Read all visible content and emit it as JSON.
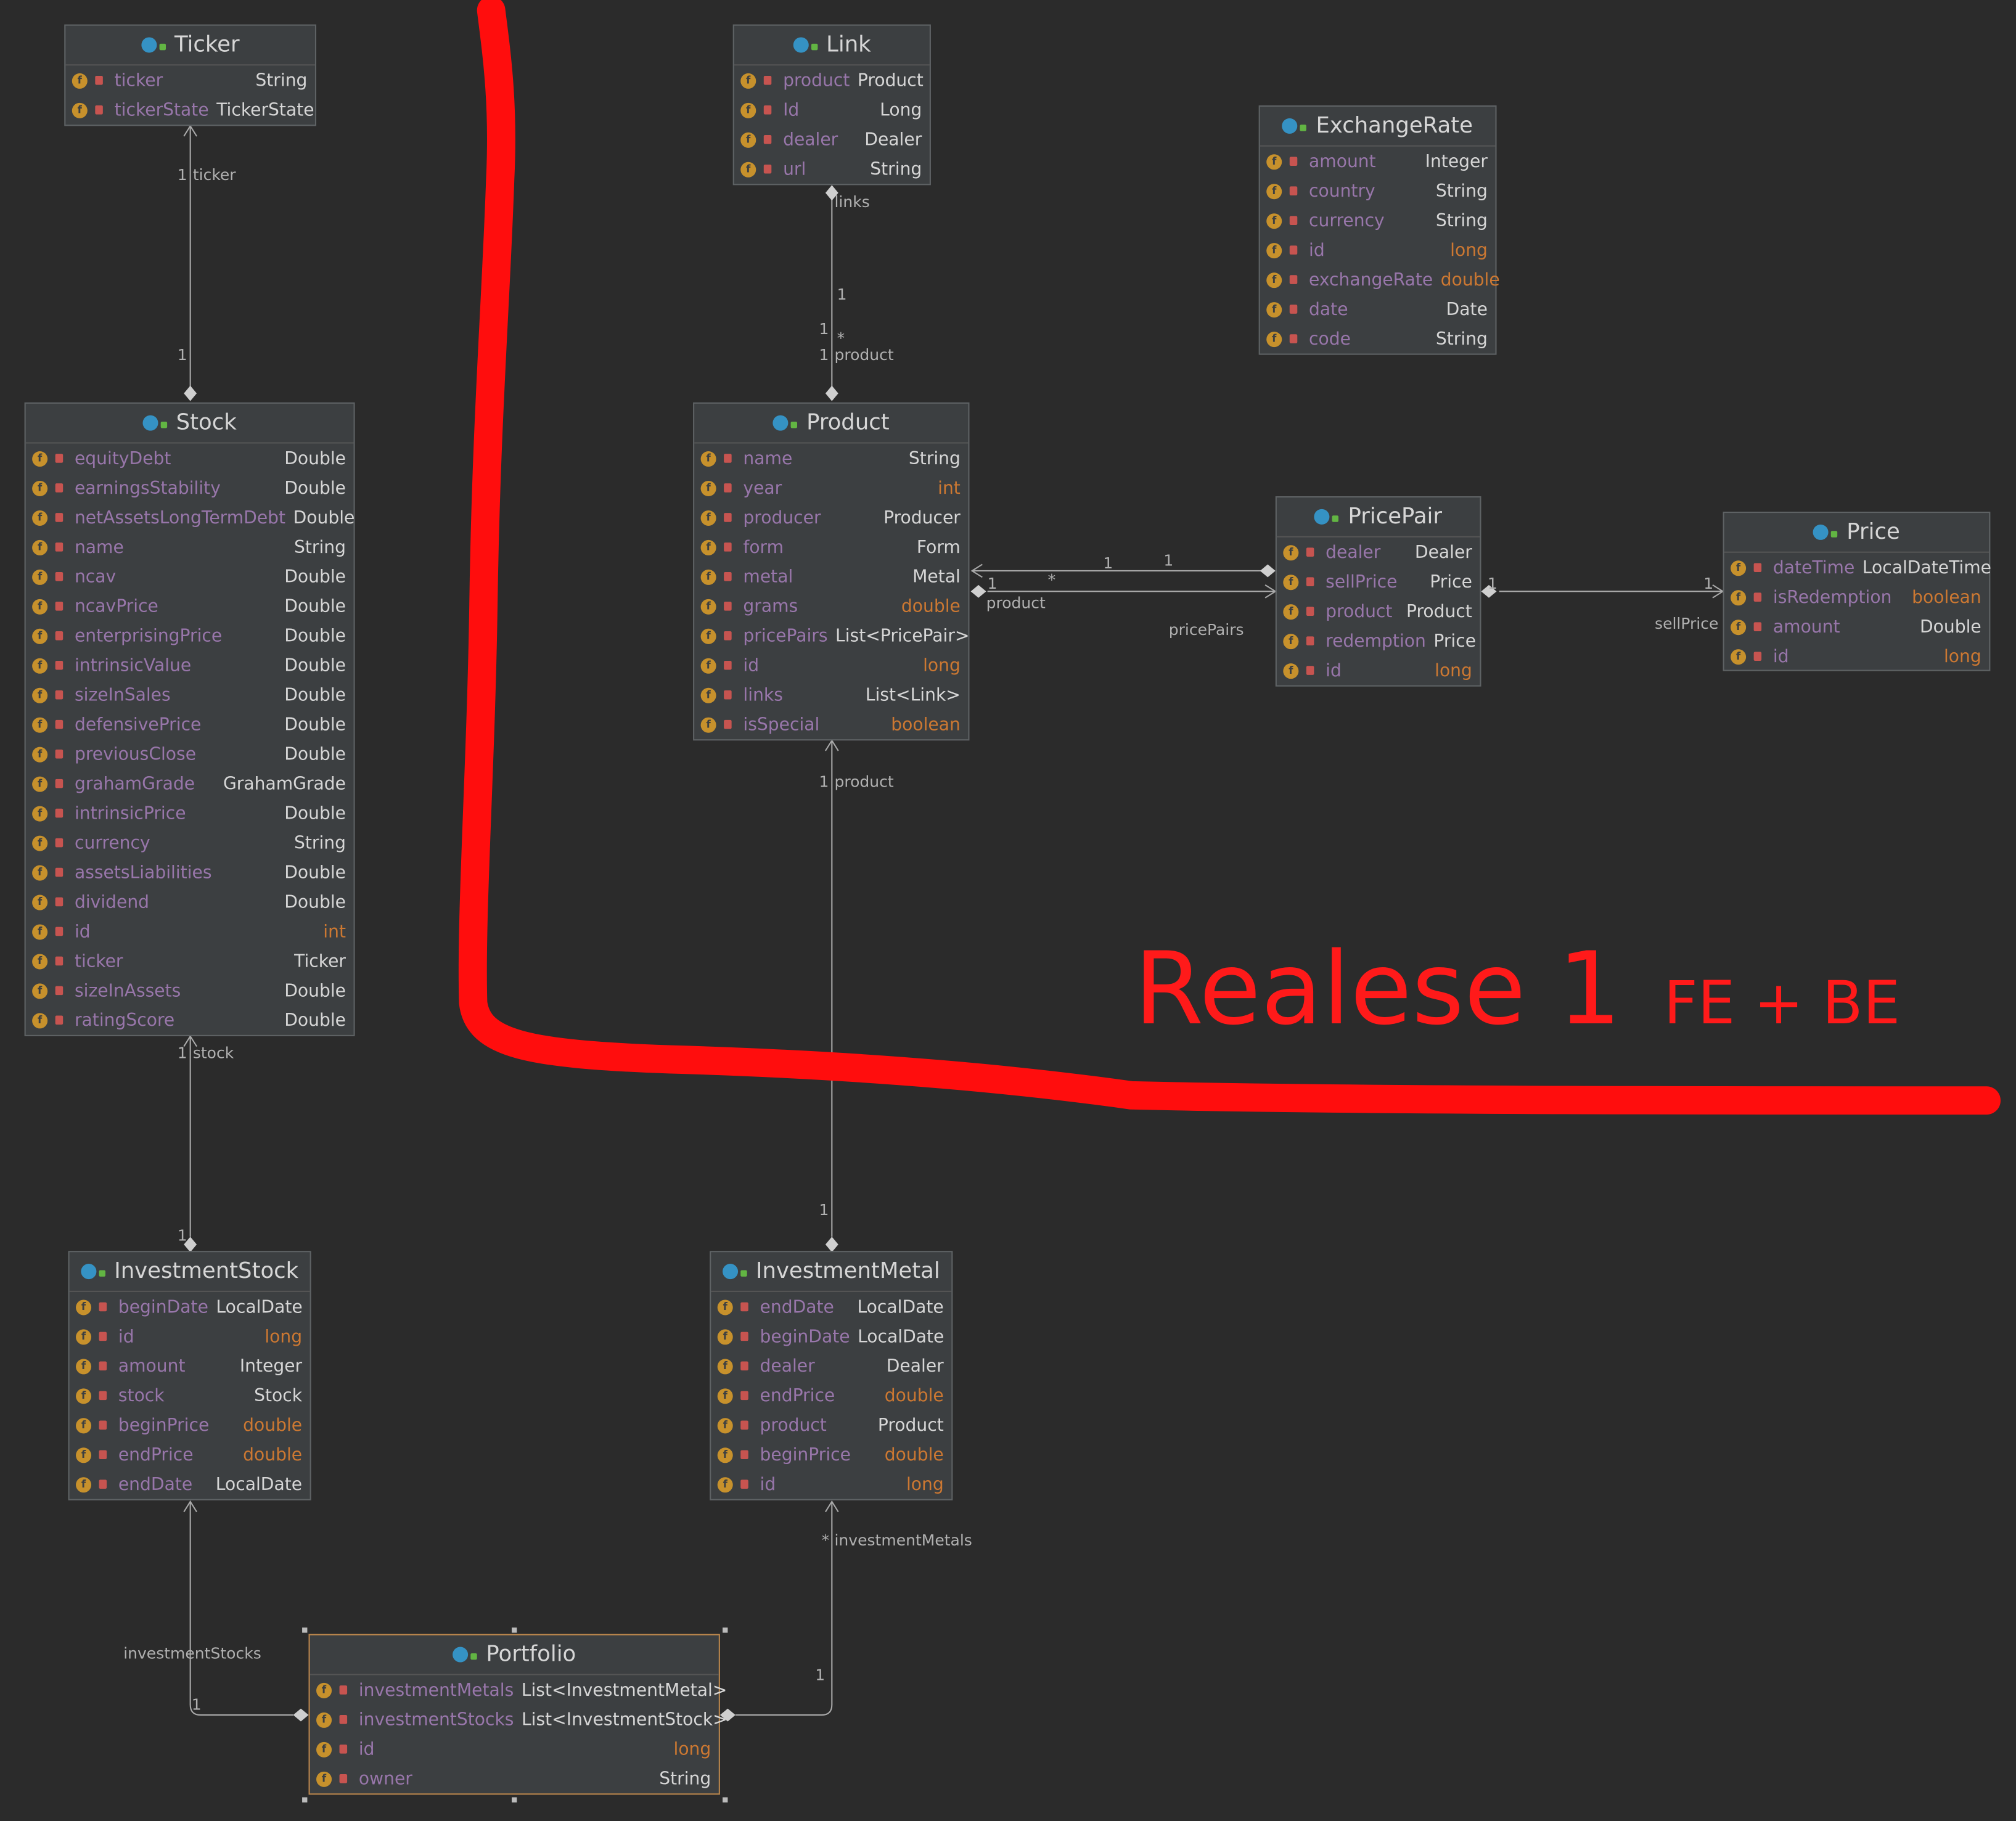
{
  "colors": {
    "background": "#2b2b2b",
    "box": "#3c3f41",
    "field_name": "#9876aa",
    "field_type": "#d6d6d6",
    "keyword_type": "#cc7832",
    "annotation": "#ff1a1a"
  },
  "annotation": {
    "main": "Realese 1",
    "sub": "FE + BE"
  },
  "classes": {
    "ticker": {
      "name": "Ticker",
      "fields": [
        [
          "ticker",
          "String"
        ],
        [
          "tickerState",
          "TickerState"
        ]
      ]
    },
    "link": {
      "name": "Link",
      "fields": [
        [
          "product",
          "Product"
        ],
        [
          "Id",
          "Long"
        ],
        [
          "dealer",
          "Dealer"
        ],
        [
          "url",
          "String"
        ]
      ]
    },
    "exchange_rate": {
      "name": "ExchangeRate",
      "fields": [
        [
          "amount",
          "Integer"
        ],
        [
          "country",
          "String"
        ],
        [
          "currency",
          "String"
        ],
        [
          "id",
          "long"
        ],
        [
          "exchangeRate",
          "double"
        ],
        [
          "date",
          "Date"
        ],
        [
          "code",
          "String"
        ]
      ]
    },
    "stock": {
      "name": "Stock",
      "fields": [
        [
          "equityDebt",
          "Double"
        ],
        [
          "earningsStability",
          "Double"
        ],
        [
          "netAssetsLongTermDebt",
          "Double"
        ],
        [
          "name",
          "String"
        ],
        [
          "ncav",
          "Double"
        ],
        [
          "ncavPrice",
          "Double"
        ],
        [
          "enterprisingPrice",
          "Double"
        ],
        [
          "intrinsicValue",
          "Double"
        ],
        [
          "sizeInSales",
          "Double"
        ],
        [
          "defensivePrice",
          "Double"
        ],
        [
          "previousClose",
          "Double"
        ],
        [
          "grahamGrade",
          "GrahamGrade"
        ],
        [
          "intrinsicPrice",
          "Double"
        ],
        [
          "currency",
          "String"
        ],
        [
          "assetsLiabilities",
          "Double"
        ],
        [
          "dividend",
          "Double"
        ],
        [
          "id",
          "int"
        ],
        [
          "ticker",
          "Ticker"
        ],
        [
          "sizeInAssets",
          "Double"
        ],
        [
          "ratingScore",
          "Double"
        ]
      ]
    },
    "product": {
      "name": "Product",
      "fields": [
        [
          "name",
          "String"
        ],
        [
          "year",
          "int"
        ],
        [
          "producer",
          "Producer"
        ],
        [
          "form",
          "Form"
        ],
        [
          "metal",
          "Metal"
        ],
        [
          "grams",
          "double"
        ],
        [
          "pricePairs",
          "List<PricePair>"
        ],
        [
          "id",
          "long"
        ],
        [
          "links",
          "List<Link>"
        ],
        [
          "isSpecial",
          "boolean"
        ]
      ]
    },
    "price_pair": {
      "name": "PricePair",
      "fields": [
        [
          "dealer",
          "Dealer"
        ],
        [
          "sellPrice",
          "Price"
        ],
        [
          "product",
          "Product"
        ],
        [
          "redemption",
          "Price"
        ],
        [
          "id",
          "long"
        ]
      ]
    },
    "price": {
      "name": "Price",
      "fields": [
        [
          "dateTime",
          "LocalDateTime"
        ],
        [
          "isRedemption",
          "boolean"
        ],
        [
          "amount",
          "Double"
        ],
        [
          "id",
          "long"
        ]
      ]
    },
    "investment_stock": {
      "name": "InvestmentStock",
      "fields": [
        [
          "beginDate",
          "LocalDate"
        ],
        [
          "id",
          "long"
        ],
        [
          "amount",
          "Integer"
        ],
        [
          "stock",
          "Stock"
        ],
        [
          "beginPrice",
          "double"
        ],
        [
          "endPrice",
          "double"
        ],
        [
          "endDate",
          "LocalDate"
        ]
      ]
    },
    "investment_metal": {
      "name": "InvestmentMetal",
      "fields": [
        [
          "endDate",
          "LocalDate"
        ],
        [
          "beginDate",
          "LocalDate"
        ],
        [
          "dealer",
          "Dealer"
        ],
        [
          "endPrice",
          "double"
        ],
        [
          "product",
          "Product"
        ],
        [
          "beginPrice",
          "double"
        ],
        [
          "id",
          "long"
        ]
      ]
    },
    "portfolio": {
      "name": "Portfolio",
      "fields": [
        [
          "investmentMetals",
          "List<InvestmentMetal>"
        ],
        [
          "investmentStocks",
          "List<InvestmentStock>"
        ],
        [
          "id",
          "long"
        ],
        [
          "owner",
          "String"
        ]
      ]
    }
  },
  "edge_labels": {
    "ticker_role": "ticker",
    "ticker_mult_top": "1",
    "ticker_mult_bottom": "1",
    "links_role": "links",
    "links_mult_a": "1",
    "links_mult_b": "1",
    "links_mult_c": "*",
    "links_mult_d": "1",
    "product_role": "product",
    "pp_mult_a": "1",
    "pp_mult_b": "1",
    "pp_mult_c": "*",
    "pp_mult_d": "1",
    "pp_product_role": "product",
    "pricepairs_role": "pricePairs",
    "sellprice_mult_a": "1",
    "sellprice_mult_b": "1",
    "sellprice_role": "sellPrice",
    "stock_role": "stock",
    "stock_mult_top": "1",
    "stock_mult_bottom": "1",
    "im_product_role": "product",
    "im_mult_top": "1",
    "im_mult_bottom": "1",
    "invstocks_role": "investmentStocks",
    "invstocks_mult": "1",
    "invmetals_role": "investmentMetals",
    "invmetals_mult_top": "*",
    "invmetals_mult_bottom": "1"
  }
}
